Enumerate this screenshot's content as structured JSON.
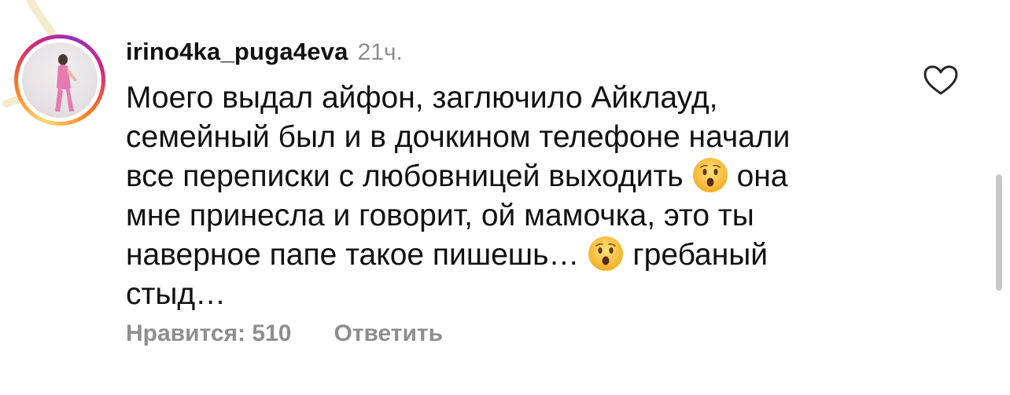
{
  "comment": {
    "username": "irino4ka_puga4eva",
    "time": "21ч.",
    "lines": [
      {
        "before": "Моего выдал айфон, заглючило Айклауд,",
        "after": ""
      },
      {
        "before": "семейный был и в дочкином телефоне начали",
        "after": ""
      },
      {
        "before": "все переписки с любовницей выходить",
        "after": "она"
      },
      {
        "before": "мне принесла и говорит, ой мамочка, это ты",
        "after": ""
      },
      {
        "before": "наверное папе такое пишешь…",
        "after": "гребаный"
      },
      {
        "before": "стыд…",
        "after": ""
      }
    ],
    "emoji": "hushed-face-emoji",
    "likes_label": "Нравится: 510",
    "reply_label": "Ответить"
  },
  "icons": {
    "like": "heart-outline-icon"
  },
  "colors": {
    "text": "#111111",
    "secondary": "#8e8e8e",
    "story_ring": [
      "#feda75",
      "#fa7e1e",
      "#d62976",
      "#962fbf"
    ],
    "emoji_face": "#f6c343"
  }
}
